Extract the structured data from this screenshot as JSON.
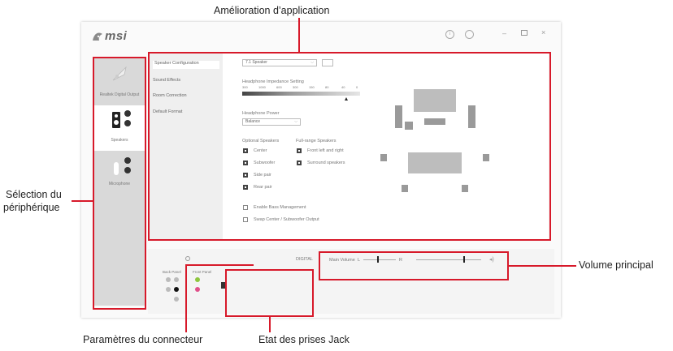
{
  "callouts": {
    "app_enhancement": "Amélioration d’application",
    "device_selection_line1": "Sélection du",
    "device_selection_line2": "périphérique",
    "main_volume": "Volume principal",
    "connector_settings": "Paramètres du connecteur",
    "jack_status": "Etat des prises Jack"
  },
  "app": {
    "logo": "msi",
    "window_controls": [
      "minimize",
      "maximize",
      "close"
    ]
  },
  "devices": [
    {
      "label": "Realtek Digital Output",
      "icon": "digital-output-icon"
    },
    {
      "label": "Speakers",
      "icon": "speaker-icon"
    },
    {
      "label": "Microphone",
      "icon": "microphone-icon"
    }
  ],
  "menu": [
    "Speaker Configuration",
    "Sound Effects",
    "Room Correction",
    "Default Format"
  ],
  "config": {
    "speaker_select": "7.1 Speaker",
    "impedance_label": "Headphone Impedance Setting",
    "impedance_ticks": [
      "300",
      "1000",
      "600",
      "300",
      "150",
      "80",
      "40",
      "0"
    ],
    "power_label": "Headphone Power",
    "power_value": "Balance",
    "optional_label": "Optional Speakers",
    "optional": [
      {
        "label": "Center",
        "checked": true
      },
      {
        "label": "Subwoofer",
        "checked": true
      },
      {
        "label": "Side pair",
        "checked": true
      },
      {
        "label": "Rear pair",
        "checked": true
      }
    ],
    "fullrange_label": "Full-range Speakers",
    "fullrange": [
      {
        "label": "Front left and right",
        "checked": true
      },
      {
        "label": "Surround speakers",
        "checked": true
      }
    ],
    "bass_mgmt": "Enable Bass Management",
    "swap": "Swap Center / Subwoofer Output"
  },
  "bottom": {
    "digital_label": "DIGITAL",
    "main_volume_label": "Main Volume",
    "balance_left": "L",
    "balance_right": "R",
    "balance_level": 0.45,
    "volume_level": 0.75,
    "back_panel": "Back Panel",
    "front_panel": "Front Panel"
  },
  "colors": {
    "accent": "#d7192a",
    "jack_black": "#111111",
    "jack_pink": "#e0508a",
    "jack_green": "#8ec63f",
    "jack_grey": "#bbbbbb"
  }
}
